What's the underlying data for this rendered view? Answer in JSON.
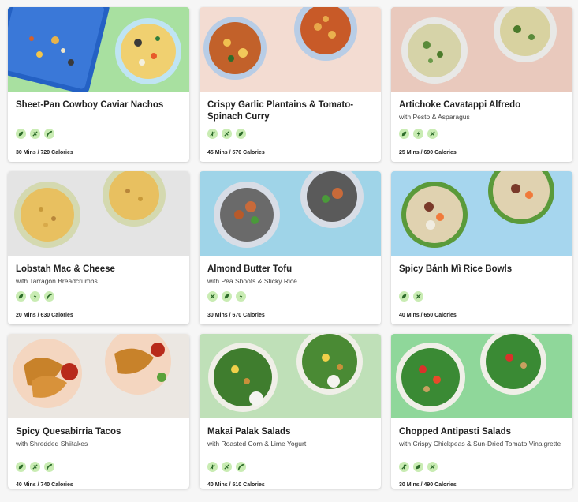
{
  "recipes": [
    {
      "title": "Sheet-Pan Cowboy Caviar Nachos",
      "subtitle": "",
      "meta": "30 Mins / 720 Calories",
      "icons": [
        "leaf-icon",
        "no-meat-icon",
        "pepper-icon"
      ],
      "bg": "#a8e0a0"
    },
    {
      "title": "Crispy Garlic Plantains & Tomato-Spinach Curry",
      "subtitle": "",
      "meta": "45 Mins / 570 Calories",
      "icons": [
        "no-gluten-icon",
        "no-meat-icon",
        "leaf-icon"
      ],
      "bg": "#f3dcd2"
    },
    {
      "title": "Artichoke Cavatappi Alfredo",
      "subtitle": "with Pesto & Asparagus",
      "meta": "25 Mins / 690 Calories",
      "icons": [
        "leaf-icon",
        "lightning-icon",
        "no-meat-icon"
      ],
      "bg": "#e9c9bd"
    },
    {
      "title": "Lobstah Mac & Cheese",
      "subtitle": "with Tarragon Breadcrumbs",
      "meta": "20 Mins / 630 Calories",
      "icons": [
        "leaf-icon",
        "lightning-icon",
        "pepper-icon"
      ],
      "bg": "#e4e4e4"
    },
    {
      "title": "Almond Butter Tofu",
      "subtitle": "with Pea Shoots & Sticky Rice",
      "meta": "30 Mins / 670 Calories",
      "icons": [
        "no-meat-icon",
        "leaf-icon",
        "lightning-icon"
      ],
      "bg": "#9fd4e8"
    },
    {
      "title": "Spicy Bánh Mì Rice Bowls",
      "subtitle": "",
      "meta": "40 Mins / 650 Calories",
      "icons": [
        "leaf-icon",
        "no-meat-icon"
      ],
      "bg": "#a6d6ee"
    },
    {
      "title": "Spicy Quesabirria Tacos",
      "subtitle": "with Shredded Shiitakes",
      "meta": "40 Mins / 740 Calories",
      "icons": [
        "leaf-icon",
        "no-meat-icon",
        "pepper-icon"
      ],
      "bg": "#ebe7e2"
    },
    {
      "title": "Makai Palak Salads",
      "subtitle": "with Roasted Corn & Lime Yogurt",
      "meta": "40 Mins / 510 Calories",
      "icons": [
        "no-gluten-icon",
        "no-meat-icon",
        "pepper-icon"
      ],
      "bg": "#bfe0b8"
    },
    {
      "title": "Chopped Antipasti Salads",
      "subtitle": "with Crispy Chickpeas & Sun-Dried Tomato Vinaigrette",
      "meta": "30 Mins / 490 Calories",
      "icons": [
        "no-gluten-icon",
        "leaf-icon",
        "no-meat-icon"
      ],
      "bg": "#8fd79a"
    }
  ]
}
